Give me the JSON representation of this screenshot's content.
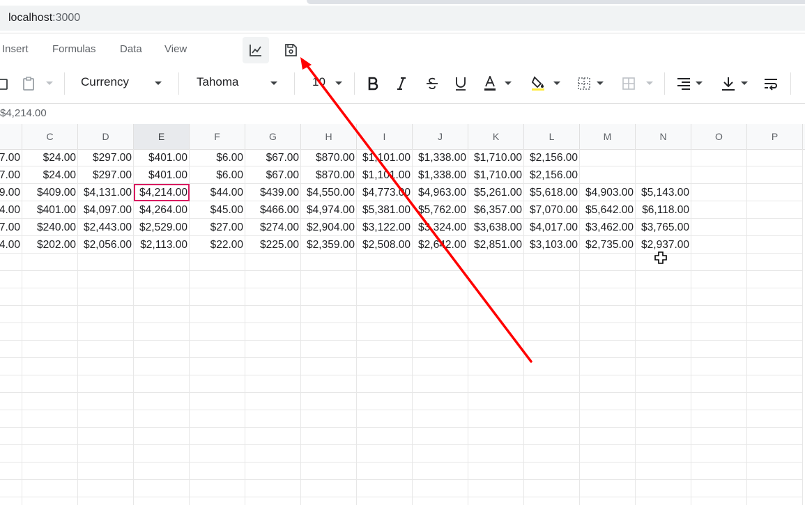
{
  "browser": {
    "url_host": "localhost",
    "url_port": ":3000"
  },
  "menu": {
    "items": [
      "Insert",
      "Formulas",
      "Data",
      "View"
    ]
  },
  "toolbar": {
    "number_format": "Currency",
    "font_family": "Tahoma",
    "font_size": "10"
  },
  "formula_bar": {
    "value": "$4,214.00"
  },
  "columns": [
    "C",
    "D",
    "E",
    "F",
    "G",
    "H",
    "I",
    "J",
    "K",
    "L",
    "M",
    "N",
    "O",
    "P"
  ],
  "selected_column": "E",
  "rows": [
    [
      "7.00",
      "$24.00",
      "$297.00",
      "$401.00",
      "$6.00",
      "$67.00",
      "$870.00",
      "$1,101.00",
      "$1,338.00",
      "$1,710.00",
      "$2,156.00",
      "",
      "",
      "",
      ""
    ],
    [
      "7.00",
      "$24.00",
      "$297.00",
      "$401.00",
      "$6.00",
      "$67.00",
      "$870.00",
      "$1,101.00",
      "$1,338.00",
      "$1,710.00",
      "$2,156.00",
      "",
      "",
      "",
      ""
    ],
    [
      "9.00",
      "$409.00",
      "$4,131.00",
      "$4,214.00",
      "$44.00",
      "$439.00",
      "$4,550.00",
      "$4,773.00",
      "$4,963.00",
      "$5,261.00",
      "$5,618.00",
      "$4,903.00",
      "$5,143.00",
      "",
      ""
    ],
    [
      "4.00",
      "$401.00",
      "$4,097.00",
      "$4,264.00",
      "$45.00",
      "$466.00",
      "$4,974.00",
      "$5,381.00",
      "$5,762.00",
      "$6,357.00",
      "$7,070.00",
      "$5,642.00",
      "$6,118.00",
      "",
      ""
    ],
    [
      "7.00",
      "$240.00",
      "$2,443.00",
      "$2,529.00",
      "$27.00",
      "$274.00",
      "$2,904.00",
      "$3,122.00",
      "$3,324.00",
      "$3,638.00",
      "$4,017.00",
      "$3,462.00",
      "$3,765.00",
      "",
      ""
    ],
    [
      "4.00",
      "$202.00",
      "$2,056.00",
      "$2,113.00",
      "$22.00",
      "$225.00",
      "$2,359.00",
      "$2,508.00",
      "$2,642.00",
      "$2,851.00",
      "$3,103.00",
      "$2,735.00",
      "$2,937.00",
      "",
      ""
    ]
  ],
  "selected_cell": {
    "row": 2,
    "col": 3
  },
  "colors": {
    "selection": "#d81b60",
    "annotation_arrow": "#ff0000",
    "highlight_fill": "#ffeb3b"
  },
  "icons": [
    "copy-icon",
    "paste-icon",
    "chart-icon",
    "save-icon",
    "bold-icon",
    "italic-icon",
    "strikethrough-icon",
    "underline-icon",
    "font-color-icon",
    "fill-color-icon",
    "borders-icon",
    "merge-cells-icon",
    "align-horizontal-icon",
    "align-vertical-icon",
    "wrap-text-icon"
  ]
}
